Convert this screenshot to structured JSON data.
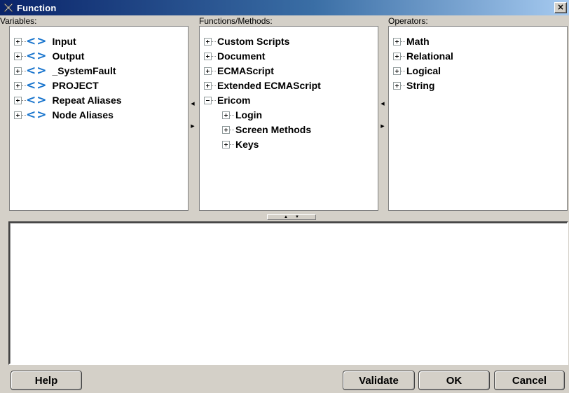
{
  "window": {
    "title": "Function",
    "close_label": "×"
  },
  "variables": {
    "label": "Variables:",
    "icon_text": "<>",
    "items": [
      "Input",
      "Output",
      "_SystemFault",
      "PROJECT",
      "Repeat Aliases",
      "Node Aliases"
    ]
  },
  "functions": {
    "label": "Functions/Methods:",
    "items": [
      "Custom Scripts",
      "Document",
      "ECMAScript",
      "Extended ECMAScript",
      "Ericom"
    ],
    "ericom_children": [
      "Login",
      "Screen Methods",
      "Keys"
    ]
  },
  "operators": {
    "label": "Operators:",
    "items": [
      "Math",
      "Relational",
      "Logical",
      "String"
    ]
  },
  "buttons": {
    "help": "Help",
    "validate": "Validate",
    "ok": "OK",
    "cancel": "Cancel"
  },
  "icons": {
    "app": "wrench-x-icon",
    "expand": "plus-box-icon",
    "collapse": "minus-box-icon",
    "variable": "angle-brackets-icon"
  }
}
